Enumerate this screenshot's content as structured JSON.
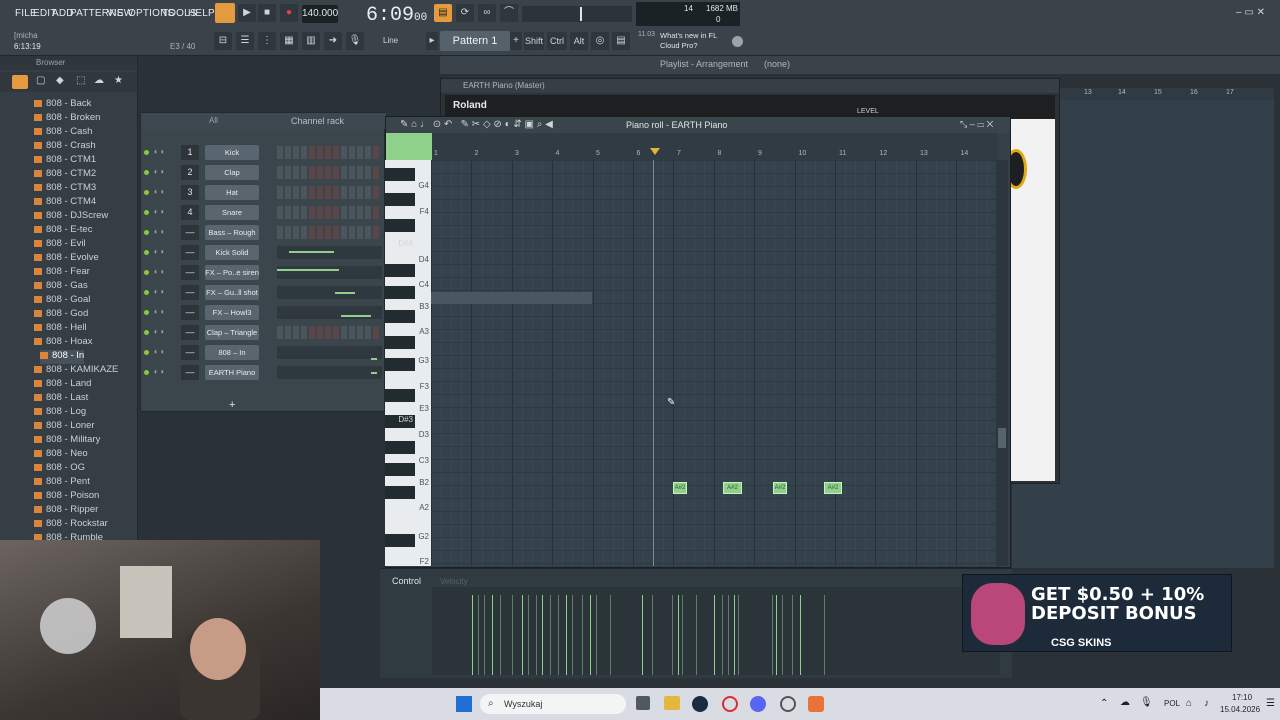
{
  "menu": [
    "FILE",
    "EDIT",
    "ADD",
    "PATTERNS",
    "VIEW",
    "OPTIONS",
    "TOOLS",
    "HELP"
  ],
  "user": "[micha",
  "user_time": "6:13:19",
  "step_info": "E3 / 40",
  "tempo": "140.000",
  "time_main": "6:09",
  "time_sub": "00",
  "cpu": "14",
  "memory": "1682 MB",
  "memory_sub": "0",
  "snap": "Line",
  "pattern": "Pattern 1",
  "modifiers": [
    "Shift",
    "Ctrl",
    "Alt"
  ],
  "news_date": "11.03",
  "news_text": "What's new in FL Cloud Pro?",
  "browser": {
    "title": "Browser",
    "items": [
      "808 - Back",
      "808 - Broken",
      "808 - Cash",
      "808 - Crash",
      "808 - CTM1",
      "808 - CTM2",
      "808 - CTM3",
      "808 - CTM4",
      "808 - DJScrew",
      "808 - E-tec",
      "808 - Evil",
      "808 - Evolve",
      "808 - Fear",
      "808 - Gas",
      "808 - Goal",
      "808 - God",
      "808 - Hell",
      "808 - Hoax",
      "808 - In",
      "808 - KAMIKAZE",
      "808 - Land",
      "808 - Last",
      "808 - Log",
      "808 - Loner",
      "808 - Military",
      "808 - Neo",
      "808 - OG",
      "808 - Pent",
      "808 - Poison",
      "808 - Ripper",
      "808 - Rockstar",
      "808 - Rumble"
    ],
    "selected": "808 - In"
  },
  "channel_rack": {
    "title": "Channel rack",
    "filter": "All",
    "channels": [
      {
        "num": "1",
        "name": "Kick"
      },
      {
        "num": "2",
        "name": "Clap"
      },
      {
        "num": "3",
        "name": "Hat"
      },
      {
        "num": "4",
        "name": "Snare"
      },
      {
        "num": "—",
        "name": "Bass – Rough"
      },
      {
        "num": "—",
        "name": "Kick Solid"
      },
      {
        "num": "—",
        "name": "FX – Po..e siren"
      },
      {
        "num": "—",
        "name": "FX – Gu..ll shot"
      },
      {
        "num": "—",
        "name": "FX – Howl3"
      },
      {
        "num": "—",
        "name": "Clap – Triangle"
      },
      {
        "num": "—",
        "name": "808 – In"
      },
      {
        "num": "—",
        "name": "EARTH Piano"
      }
    ],
    "add": "+"
  },
  "playlist": {
    "title": "Playlist - Arrangement",
    "sub": "(none)",
    "ruler": [
      "13",
      "14",
      "15",
      "16",
      "17"
    ]
  },
  "earth": {
    "title": "EARTH Piano (Master)",
    "brand": "Roland",
    "level_label": "LEVEL"
  },
  "piano_roll": {
    "title": "Piano roll - EARTH Piano",
    "ruler": [
      "1",
      "2",
      "3",
      "4",
      "5",
      "6",
      "7",
      "8",
      "9",
      "10",
      "11",
      "12",
      "13",
      "14"
    ],
    "key_labels": [
      {
        "k": "G4",
        "t": 21
      },
      {
        "k": "F4",
        "t": 47
      },
      {
        "k": "D#4",
        "t": 79
      },
      {
        "k": "D4",
        "t": 95
      },
      {
        "k": "C4",
        "t": 120
      },
      {
        "k": "B3",
        "t": 142
      },
      {
        "k": "A3",
        "t": 167
      },
      {
        "k": "G3",
        "t": 196
      },
      {
        "k": "F3",
        "t": 222
      },
      {
        "k": "E3",
        "t": 244
      },
      {
        "k": "D#3",
        "t": 255
      },
      {
        "k": "D3",
        "t": 270
      },
      {
        "k": "C3",
        "t": 296
      },
      {
        "k": "B2",
        "t": 318
      },
      {
        "k": "A2",
        "t": 343
      },
      {
        "k": "G2",
        "t": 372
      },
      {
        "k": "F2",
        "t": 397
      }
    ],
    "notes": [
      "A#2",
      "A#2",
      "A#2",
      "A#2"
    ]
  },
  "control": {
    "label": "Control",
    "sub": "Velocity"
  },
  "ad": {
    "line1": "GET $0.50 + 10%",
    "line2": "DEPOSIT BONUS",
    "brand": "CSG SKINS"
  },
  "taskbar": {
    "search": "Wyszukaj",
    "lang": "POL",
    "clock": "17:10",
    "date": "15.04.2026"
  }
}
